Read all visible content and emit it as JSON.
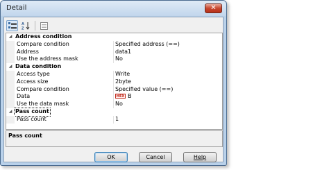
{
  "window": {
    "title": "Detail",
    "close_glyph": "✕"
  },
  "toolbar": {
    "buttons": [
      {
        "name": "categorized-view-icon",
        "active": true
      },
      {
        "name": "alphabetical-sort-icon",
        "active": false
      },
      {
        "name": "property-pages-icon",
        "active": false
      }
    ]
  },
  "grid": {
    "categories": [
      {
        "label": "Address condition",
        "props": [
          {
            "name": "Compare condition",
            "value": "Specified address (==)"
          },
          {
            "name": "Address",
            "value": "data1"
          },
          {
            "name": "Use the address mask",
            "value": "No"
          }
        ]
      },
      {
        "label": "Data condition",
        "props": [
          {
            "name": "Access type",
            "value": "Write"
          },
          {
            "name": "Access size",
            "value": "2byte"
          },
          {
            "name": "Compare condition",
            "value": "Specified value (==)"
          },
          {
            "name": "Data",
            "value": "B",
            "badge": "HEX"
          },
          {
            "name": "Use the data mask",
            "value": "No"
          }
        ]
      },
      {
        "label": "Pass count",
        "props": [
          {
            "name": "Pass count",
            "value": "1"
          }
        ]
      }
    ]
  },
  "description": {
    "title": "Pass count"
  },
  "buttons": {
    "ok": "OK",
    "cancel": "Cancel",
    "help": "Help"
  }
}
